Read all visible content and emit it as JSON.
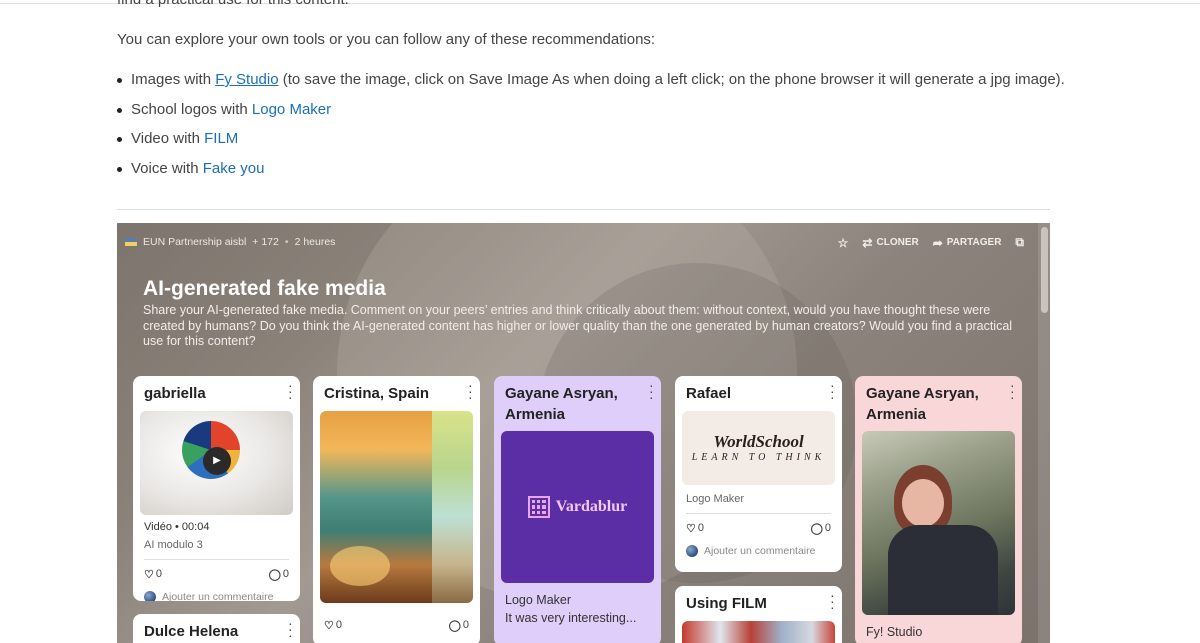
{
  "article": {
    "cut_line": "find a practical use for this content.",
    "intro": "You can explore your own tools or you can follow any of these recommendations:",
    "recommendations": [
      {
        "prefix": "Images with ",
        "link": "Fy Studio",
        "suffix": " (to save the image, click on Save Image As when doing a left click; on the phone browser it will generate a jpg image)."
      },
      {
        "prefix": "School logos with ",
        "link": "Logo Maker",
        "suffix": ""
      },
      {
        "prefix": "Video with ",
        "link": "FILM",
        "suffix": ""
      },
      {
        "prefix": "Voice with ",
        "link": "Fake you",
        "suffix": ""
      }
    ]
  },
  "padlet": {
    "owner": "EUN Partnership aisbl",
    "plus_count": "+ 172",
    "time_ago": "2 heures",
    "tools": {
      "clone": "CLONER",
      "share": "PARTAGER"
    },
    "title": "AI-generated fake media",
    "description": "Share your AI-generated fake media. Comment on your peers’ entries and think critically about them: without context, would you have thought these were created by humans? Do you think the AI-generated content has higher or lower quality than the one generated by human creators? Would you find a practical use for this content?",
    "add_comment": "Ajouter un commentaire",
    "cards": {
      "c1": {
        "title": "gabriella",
        "video_label": "Vidéo",
        "duration": "00:04",
        "caption": "AI modulo 3",
        "likes": "0",
        "comments": "0"
      },
      "c1b": {
        "title": "Dulce Helena"
      },
      "c2": {
        "title": "Cristina, Spain",
        "likes": "0",
        "comments": "0"
      },
      "c3": {
        "title": "Gayane Asryan, Armenia",
        "logo_text": "Vardablur",
        "caption_1": "Logo Maker",
        "caption_2": "It was very interesting..."
      },
      "c4": {
        "title": "Rafael",
        "logo_line1": "WorldSchool",
        "logo_line2": "LEARN TO THINK",
        "caption": "Logo Maker",
        "likes": "0",
        "comments": "0"
      },
      "c4b": {
        "title": "Using FILM"
      },
      "c5": {
        "title": "Gayane Asryan, Armenia",
        "caption": "Fy! Studio"
      }
    }
  }
}
